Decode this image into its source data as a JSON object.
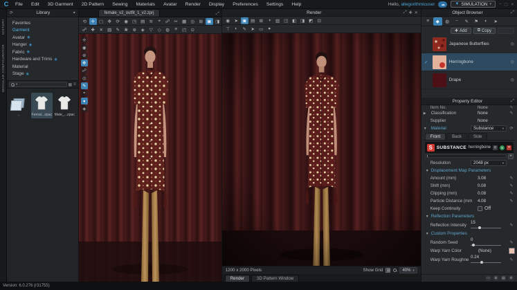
{
  "app": {
    "logo": "C",
    "menu": [
      "File",
      "Edit",
      "3D Garment",
      "2D Pattern",
      "Sewing",
      "Materials",
      "Avatar",
      "Render",
      "Display",
      "Preferences",
      "Settings",
      "Help"
    ],
    "user_greeting": "Hello,",
    "user_name": "allegorithmicuser",
    "cloud_icon_glyph": "☁",
    "simulation_button": "SIMULATION",
    "window_controls": [
      "–",
      "▢",
      "✕"
    ],
    "status_version": "Version: 6.0.276 (r31755)"
  },
  "left_rail": {
    "tabs": [
      "HISTORY",
      "MODULAR CONFIGURATOR"
    ]
  },
  "library": {
    "title": "Library",
    "categories": [
      {
        "label": "Favorites",
        "selected": false,
        "cloud": false
      },
      {
        "label": "Garment",
        "selected": true,
        "cloud": false
      },
      {
        "label": "Avatar",
        "selected": false,
        "cloud": true
      },
      {
        "label": "Hanger",
        "selected": false,
        "cloud": true
      },
      {
        "label": "Fabric",
        "selected": false,
        "cloud": true
      },
      {
        "label": "Hardware and Trims",
        "selected": false,
        "cloud": true
      },
      {
        "label": "Material",
        "selected": false,
        "cloud": false
      },
      {
        "label": "Stage",
        "selected": false,
        "cloud": true
      }
    ],
    "items": [
      {
        "label": "..",
        "type": "folder",
        "selected": false
      },
      {
        "label": "Femal...zpac",
        "type": "garment",
        "selected": true
      },
      {
        "label": "Male_...zpac",
        "type": "garment",
        "selected": false
      }
    ]
  },
  "viewport": {
    "tab": "female_v2_outfit_1_v2.zprj",
    "toolbar_row1": [
      {
        "name": "reset-view-icon",
        "glyph": "⟲"
      },
      {
        "name": "gizmo-move-icon",
        "glyph": "✛",
        "selected": true
      },
      {
        "name": "box-select-icon",
        "glyph": "▢"
      },
      {
        "name": "pan-icon",
        "glyph": "✥"
      },
      {
        "name": "rotate-icon",
        "glyph": "⟳"
      },
      {
        "name": "snapshot-icon",
        "glyph": "◉"
      },
      {
        "name": "window-icon",
        "glyph": "◳"
      },
      {
        "name": "style-icon",
        "glyph": "▤"
      },
      {
        "name": "wind-icon",
        "glyph": "≋"
      },
      {
        "name": "target-icon",
        "glyph": "⌖"
      },
      {
        "name": "link-icon",
        "glyph": "☍"
      },
      {
        "name": "scissors-icon",
        "glyph": "✂"
      },
      {
        "name": "texture-icon",
        "glyph": "▦"
      },
      {
        "name": "light-icon",
        "glyph": "◎"
      },
      {
        "name": "grid-icon",
        "glyph": "⊞"
      },
      {
        "name": "monitor-icon",
        "glyph": "▣",
        "selected": true
      },
      {
        "name": "camera-icon",
        "glyph": "◨"
      }
    ],
    "toolbar_row2": [
      {
        "name": "pin-icon",
        "glyph": "☍"
      },
      {
        "name": "add-point-icon",
        "glyph": "✚"
      },
      {
        "name": "delete-point-icon",
        "glyph": "✕"
      },
      {
        "name": "hatch-icon",
        "glyph": "▧"
      },
      {
        "name": "pen-icon",
        "glyph": "✎"
      },
      {
        "name": "flower-icon",
        "glyph": "❀"
      },
      {
        "name": "attach-icon",
        "glyph": "⊕"
      },
      {
        "name": "gem-icon",
        "glyph": "◈"
      },
      {
        "name": "down-icon",
        "glyph": "▽"
      },
      {
        "name": "diamond-icon",
        "glyph": "◇"
      },
      {
        "name": "sphere-icon",
        "glyph": "◍"
      },
      {
        "name": "layers-icon",
        "glyph": "≡"
      },
      {
        "name": "corner-icon",
        "glyph": "◰"
      },
      {
        "name": "dot-icon",
        "glyph": "⊙"
      }
    ],
    "side_strip": [
      {
        "name": "pose-icon",
        "glyph": "✛"
      },
      {
        "name": "camera-view-icon",
        "glyph": "◉"
      },
      {
        "name": "add-avatar-icon",
        "glyph": "⊕"
      },
      {
        "name": "move-avatar-icon",
        "glyph": "✥",
        "selected": true
      },
      {
        "name": "bind-icon",
        "glyph": "☍"
      },
      {
        "name": "light-view-icon",
        "glyph": "◎"
      },
      {
        "name": "annotate-icon",
        "glyph": "✎",
        "selected": true
      },
      {
        "name": "focus-icon",
        "glyph": "⌖"
      },
      {
        "name": "avatar-dot-icon",
        "glyph": "●",
        "selected": true
      },
      {
        "name": "material-ball-icon",
        "glyph": "◈"
      }
    ]
  },
  "render_window": {
    "title": "Render",
    "header_icons": [
      {
        "name": "float-icon",
        "glyph": "⤢"
      },
      {
        "name": "add-icon",
        "glyph": "✚"
      },
      {
        "name": "close-icon",
        "glyph": "✕"
      }
    ],
    "toolbar_row1": [
      {
        "name": "render-camera-icon",
        "glyph": "◉"
      },
      {
        "name": "render-play-icon",
        "glyph": "➤"
      },
      {
        "name": "render-monitor-icon",
        "glyph": "▣",
        "selected": true
      },
      {
        "name": "render-props-icon",
        "glyph": "▤"
      },
      {
        "name": "render-grid-icon",
        "glyph": "⊞"
      },
      {
        "name": "render-clock-icon",
        "glyph": "◑"
      },
      {
        "name": "render-rows-icon",
        "glyph": "▥"
      },
      {
        "name": "render-split-icon",
        "glyph": "◫"
      },
      {
        "name": "render-left-icon",
        "glyph": "◧"
      },
      {
        "name": "render-right-icon",
        "glyph": "◨"
      },
      {
        "name": "render-corner-icon",
        "glyph": "◩"
      },
      {
        "name": "render-save-icon",
        "glyph": "⊡"
      }
    ],
    "toolbar_row2": [
      {
        "name": "render-light-icon",
        "glyph": "⊤"
      },
      {
        "name": "render-env-icon",
        "glyph": "◐"
      },
      {
        "name": "render-pen-icon",
        "glyph": "✎"
      },
      {
        "name": "render-arrow-icon",
        "glyph": "➤"
      },
      {
        "name": "render-plane-icon",
        "glyph": "▭"
      },
      {
        "name": "render-sphere-icon",
        "glyph": "●"
      }
    ],
    "image_size": "1200 x 2000 Pixels",
    "show_grid_label": "Show Grid",
    "zoom": "40%",
    "tabs": [
      {
        "label": "Render",
        "selected": true
      },
      {
        "label": "3D Pattern Window",
        "selected": false
      }
    ]
  },
  "object_browser": {
    "title": "Object Browser",
    "tab_icons": [
      {
        "name": "list-icon",
        "glyph": "≡"
      },
      {
        "name": "garment-icon",
        "glyph": "◆",
        "selected": true
      },
      {
        "name": "avatar-icon",
        "glyph": "◍"
      },
      {
        "name": "trim-icon",
        "glyph": "−"
      },
      {
        "name": "sewing-pen-icon",
        "glyph": "✎"
      },
      {
        "name": "tag-icon",
        "glyph": "⚑"
      },
      {
        "name": "fabric-ball-icon",
        "glyph": "◐"
      },
      {
        "name": "more-icon",
        "glyph": "➤"
      }
    ],
    "add_button": "Add",
    "copy_button": "Copy",
    "items": [
      {
        "name": "Japanese Butterflies",
        "selected": false,
        "kind": "butterflies"
      },
      {
        "name": "Herringbone",
        "selected": true,
        "kind": "herringbone"
      },
      {
        "name": "Drape",
        "selected": false,
        "kind": "drape"
      }
    ]
  },
  "property_editor": {
    "title": "Property Editor",
    "top_rows": [
      {
        "label": "Item No.",
        "value": "None",
        "clipped": true,
        "pencil": true
      },
      {
        "label": "Classification",
        "value": "None",
        "arrow": "▶",
        "pencil": true
      },
      {
        "label": "Supplier",
        "value": "None",
        "pencil": false
      }
    ],
    "material_label": "Material",
    "material_value": "Substance",
    "tabs": [
      {
        "label": "Front",
        "selected": true
      },
      {
        "label": "Back",
        "selected": false
      },
      {
        "label": "Side",
        "selected": false
      }
    ],
    "substance": {
      "brand": "SUBSTANCE",
      "name": "herringbone",
      "icons": [
        {
          "name": "expand-icon",
          "glyph": "⊡",
          "style": ""
        },
        {
          "name": "substance-sync-icon",
          "glyph": "S",
          "style": "green"
        },
        {
          "name": "remove-icon",
          "glyph": "✕",
          "style": "red"
        }
      ],
      "add_button": "+"
    },
    "resolution_label": "Resolution",
    "resolution_value": "2048 px",
    "sections": [
      {
        "title": "Displacement Map Parameters",
        "rows": [
          {
            "label": "Amount (mm)",
            "value": "3.08",
            "type": "edit"
          },
          {
            "label": "Shift (mm)",
            "value": "0.08",
            "type": "edit"
          },
          {
            "label": "Clipping (mm)",
            "value": "0.08",
            "type": "edit"
          },
          {
            "label": "Particle Distance (mm",
            "value": "4.08",
            "type": "edit"
          },
          {
            "label": "Keep Continuity",
            "value": "Off",
            "type": "toggle"
          }
        ]
      },
      {
        "title": "Reflection Parameters",
        "rows": [
          {
            "label": "Reflection Intensity",
            "value": "15",
            "type": "slider",
            "pos": 0.28
          }
        ]
      },
      {
        "title": "Custom Properties",
        "rows": [
          {
            "label": "Random Seed",
            "value": "0",
            "type": "slider",
            "pos": 0.05
          },
          {
            "label": "Warp Yarn Color",
            "value": "(None)",
            "type": "color",
            "swatch": "#e9c2b2"
          },
          {
            "label": "Warp Yarn Roughne",
            "value": "0.24",
            "type": "slider",
            "pos": 0.35
          }
        ]
      }
    ],
    "footer_icons": [
      {
        "name": "page-prev-icon",
        "glyph": "▭"
      },
      {
        "name": "page-grid-icon",
        "glyph": "⊞"
      },
      {
        "name": "page-list-icon",
        "glyph": "▤"
      },
      {
        "name": "settings-gear-icon",
        "glyph": "⚙"
      }
    ]
  },
  "colors": {
    "accent_blue": "#4da6da",
    "selection_row": "#2d4a61",
    "substance_red": "#d43a30",
    "curtain_maroon": "#401617",
    "shirt_maroon": "#5e201d",
    "pattern_cream": "#e6d3a3",
    "legs_gold": "#a57c46"
  }
}
